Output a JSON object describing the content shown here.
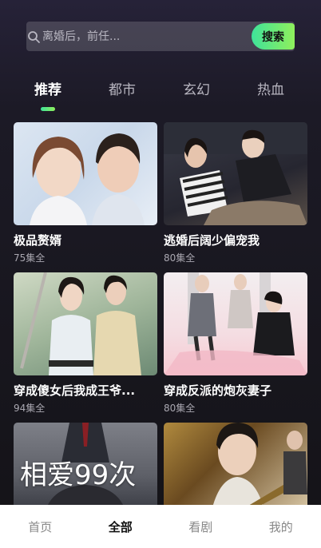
{
  "search": {
    "placeholder": "离婚后，前任...",
    "button_label": "搜索"
  },
  "tabs": [
    {
      "label": "推荐",
      "active": true
    },
    {
      "label": "都市",
      "active": false
    },
    {
      "label": "玄幻",
      "active": false
    },
    {
      "label": "热血",
      "active": false
    }
  ],
  "dramas": [
    {
      "title": "极品赘婿",
      "episodes": "75集全"
    },
    {
      "title": "逃婚后阔少偏宠我",
      "episodes": "80集全"
    },
    {
      "title": "穿成傻女后我成王爷...",
      "episodes": "94集全"
    },
    {
      "title": "穿成反派的炮灰妻子",
      "episodes": "80集全"
    },
    {
      "title": "",
      "episodes": "",
      "poster_text": "相爱99次"
    },
    {
      "title": "",
      "episodes": ""
    }
  ],
  "bottom_nav": [
    {
      "label": "首页",
      "active": false
    },
    {
      "label": "全部",
      "active": true
    },
    {
      "label": "看剧",
      "active": false
    },
    {
      "label": "我的",
      "active": false
    }
  ],
  "colors": {
    "accent_start": "#3fe29a",
    "accent_end": "#8ff05c",
    "background": "#1c1a26"
  }
}
